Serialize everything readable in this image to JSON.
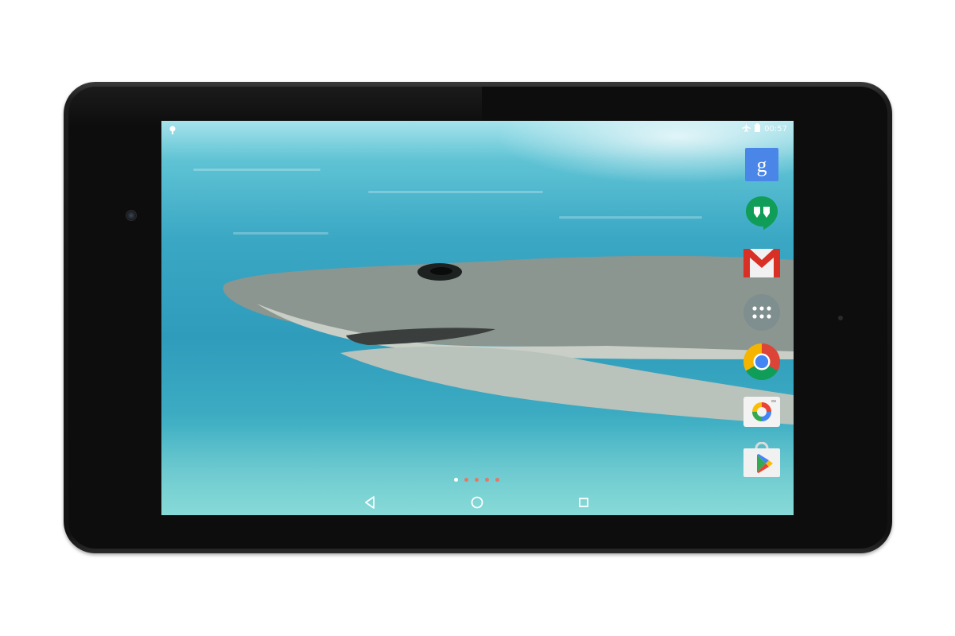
{
  "device": {
    "type": "android-tablet"
  },
  "status_bar": {
    "time": "00:57",
    "left_icons": [
      "notification-icon"
    ],
    "right_icons": [
      "airplane-icon",
      "battery-icon"
    ]
  },
  "wallpaper": {
    "subject": "shark-underwater"
  },
  "dock": {
    "apps": [
      {
        "label": "",
        "icon": "google-search-icon"
      },
      {
        "label": "",
        "icon": "hangouts-icon"
      },
      {
        "label": "",
        "icon": "gmail-icon"
      },
      {
        "label": "",
        "icon": "app-drawer-icon"
      },
      {
        "label": "",
        "icon": "chrome-icon"
      },
      {
        "label": "",
        "icon": "photos-icon"
      },
      {
        "label": "",
        "icon": "play-store-icon"
      }
    ]
  },
  "pager": {
    "pages": 5,
    "active_index": 0,
    "active_color": "#ffffff",
    "inactive_color": "#e07a6a"
  },
  "nav_bar": {
    "buttons": [
      "back-icon",
      "home-icon",
      "recents-icon"
    ]
  },
  "colors": {
    "google_blue": "#4a86e8",
    "hangouts_green": "#0f9d58",
    "gmail_red": "#d93025"
  }
}
